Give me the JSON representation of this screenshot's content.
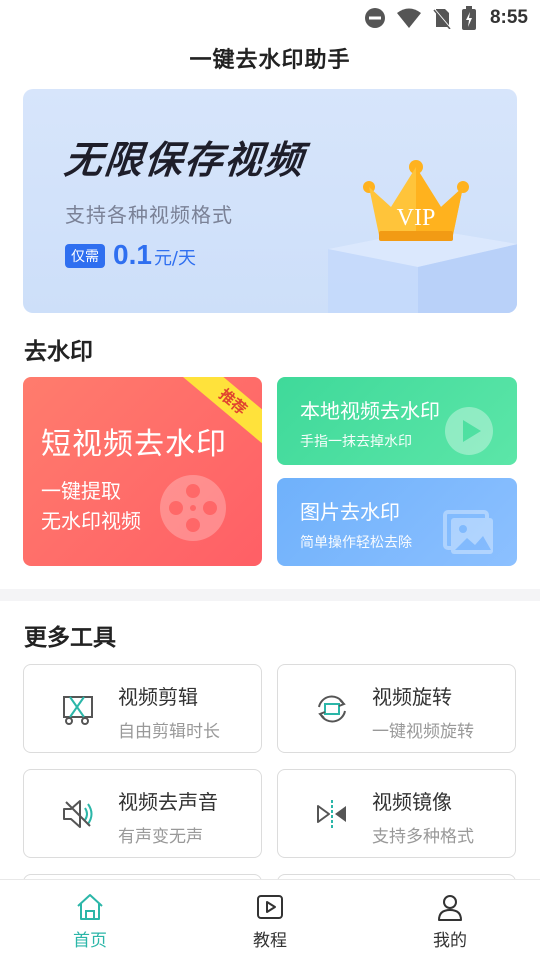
{
  "status_bar": {
    "time": "8:55"
  },
  "app": {
    "title": "一键去水印助手"
  },
  "banner": {
    "title": "无限保存视频",
    "subtitle": "支持各种视频格式",
    "price_tag": "仅需",
    "price_value": "0.1",
    "price_unit": "元/天",
    "vip_label": "VIP"
  },
  "watermark_section": {
    "title": "去水印",
    "big_card": {
      "title": "短视频去水印",
      "line1": "一键提取",
      "line2": "无水印视频",
      "ribbon": "推荐"
    },
    "local_video": {
      "title": "本地视频去水印",
      "subtitle": "手指一抹去掉水印"
    },
    "image": {
      "title": "图片去水印",
      "subtitle": "简单操作轻松去除"
    }
  },
  "tools_section": {
    "title": "更多工具",
    "items": [
      {
        "name": "视频剪辑",
        "desc": "自由剪辑时长",
        "icon": "video-cut-icon"
      },
      {
        "name": "视频旋转",
        "desc": "一键视频旋转",
        "icon": "video-rotate-icon"
      },
      {
        "name": "视频去声音",
        "desc": "有声变无声",
        "icon": "mute-icon"
      },
      {
        "name": "视频镜像",
        "desc": "支持多种格式",
        "icon": "mirror-icon"
      }
    ]
  },
  "bottom_nav": {
    "items": [
      {
        "label": "首页",
        "icon": "home-icon",
        "active": true
      },
      {
        "label": "教程",
        "icon": "play-icon",
        "active": false
      },
      {
        "label": "我的",
        "icon": "user-icon",
        "active": false
      }
    ]
  },
  "colors": {
    "accent": "#2bb6a8",
    "price_blue": "#2f6ff0",
    "card_red": "#ff6a69",
    "card_green": "#45dc9e",
    "card_blue": "#7db7fd"
  }
}
